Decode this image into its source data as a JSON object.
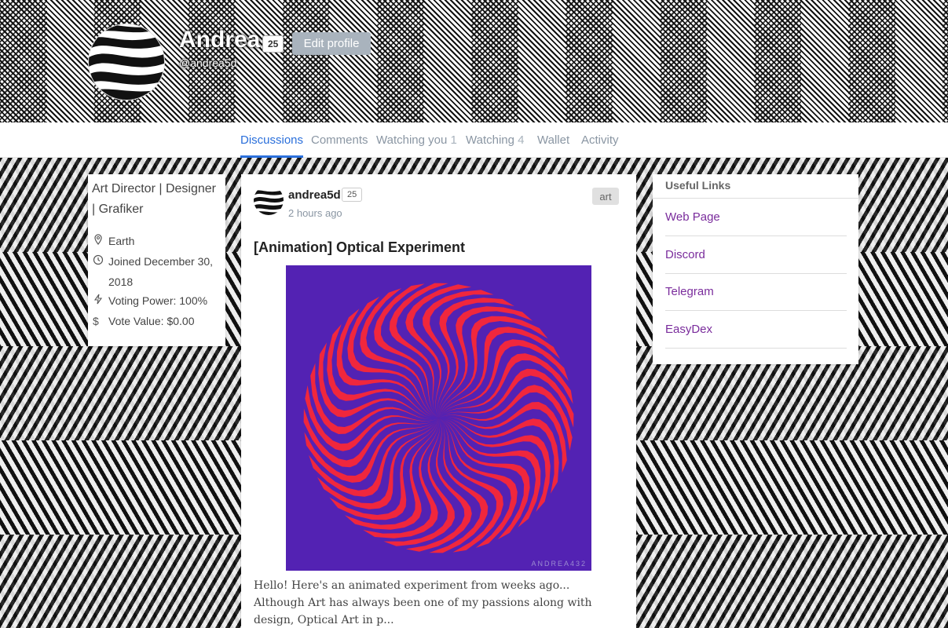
{
  "profile": {
    "name": "Andrea",
    "reputation": "25",
    "handle": "@andrea5d",
    "edit_label": "Edit profile"
  },
  "tabs": [
    {
      "label": "Discussions",
      "count": ""
    },
    {
      "label": "Comments",
      "count": ""
    },
    {
      "label": "Watching you",
      "count": "1"
    },
    {
      "label": "Watching",
      "count": "4"
    },
    {
      "label": "Wallet",
      "count": ""
    },
    {
      "label": "Activity",
      "count": ""
    }
  ],
  "info": {
    "about": "Art Director | Designer | Grafiker",
    "location": "Earth",
    "joined": "Joined December 30, 2018",
    "voting_power": "Voting Power: 100%",
    "vote_value": "Vote Value: $0.00"
  },
  "post": {
    "author": "andrea5d",
    "reputation": "25",
    "time": "2 hours ago",
    "tag": "art",
    "title": "[Animation] Optical Experiment",
    "watermark": "ANDREA432",
    "excerpt": "Hello! Here's an animated experiment from weeks ago... Although Art has always been one of my passions along with design, Optical Art in p..."
  },
  "links": {
    "title": "Useful Links",
    "items": [
      "Web Page",
      "Discord",
      "Telegram",
      "EasyDex"
    ]
  },
  "colors": {
    "accent": "#2a6fdb",
    "link": "#7a2c9c",
    "image_bg": "#5322b3",
    "image_fg": "#f0273d"
  }
}
